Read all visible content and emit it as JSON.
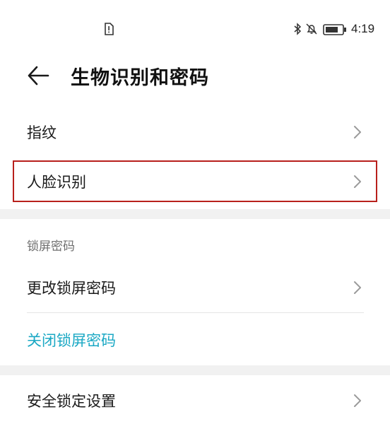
{
  "status_bar": {
    "time": "4:19",
    "icons": [
      "sim-alert-icon",
      "bluetooth-icon",
      "notifications-off-icon",
      "battery-icon"
    ]
  },
  "header": {
    "back_icon": "arrow-left-icon",
    "title": "生物识别和密码"
  },
  "biometric_items": [
    {
      "label": "指纹",
      "icon": "chevron-right-icon"
    },
    {
      "label": "人脸识别",
      "icon": "chevron-right-icon",
      "highlighted": true
    }
  ],
  "lock_screen_section": {
    "header": "锁屏密码",
    "change_label": "更改锁屏密码",
    "disable_label": "关闭锁屏密码"
  },
  "security_lock": {
    "label": "安全锁定设置"
  },
  "colors": {
    "accent": "#1aa8c4",
    "highlight_border": "#b8201c",
    "section_gap": "#f1f1f1"
  }
}
